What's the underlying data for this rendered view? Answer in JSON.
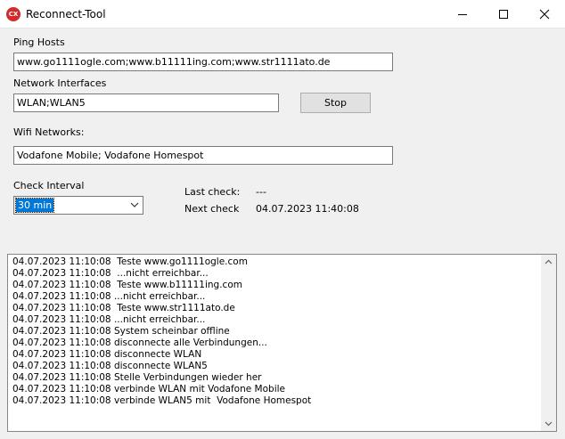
{
  "window": {
    "title": "Reconnect-Tool",
    "icon_text": "CX",
    "icon_color": "#d42a2a"
  },
  "ping_hosts": {
    "label": "Ping Hosts",
    "value": "www.go1111ogle.com;www.b11111ing.com;www.str1111ato.de"
  },
  "network_interfaces": {
    "label": "Network Interfaces",
    "value": "WLAN;WLAN5"
  },
  "stop_button": {
    "label": "Stop"
  },
  "wifi_networks": {
    "label": "Wifi Networks:",
    "value": "Vodafone Mobile; Vodafone Homespot"
  },
  "check_interval": {
    "label": "Check Interval",
    "selected": "30 min"
  },
  "status": {
    "last_check_label": "Last check:",
    "last_check_value": "---",
    "next_check_label": "Next check",
    "next_check_value": "04.07.2023 11:40:08"
  },
  "log": [
    "04.07.2023 11:10:08  Teste www.go1111ogle.com",
    "04.07.2023 11:10:08  ...nicht erreichbar...",
    "04.07.2023 11:10:08  Teste www.b11111ing.com",
    "04.07.2023 11:10:08 ...nicht erreichbar...",
    "04.07.2023 11:10:08  Teste www.str1111ato.de",
    "04.07.2023 11:10:08 ...nicht erreichbar...",
    "04.07.2023 11:10:08 System scheinbar offline",
    "04.07.2023 11:10:08 disconnecte alle Verbindungen...",
    "04.07.2023 11:10:08 disconnecte WLAN",
    "04.07.2023 11:10:08 disconnecte WLAN5",
    "04.07.2023 11:10:08 Stelle Verbindungen wieder her",
    "04.07.2023 11:10:08 verbinde WLAN mit Vodafone Mobile",
    "04.07.2023 11:10:08 verbinde WLAN5 mit  Vodafone Homespot"
  ]
}
